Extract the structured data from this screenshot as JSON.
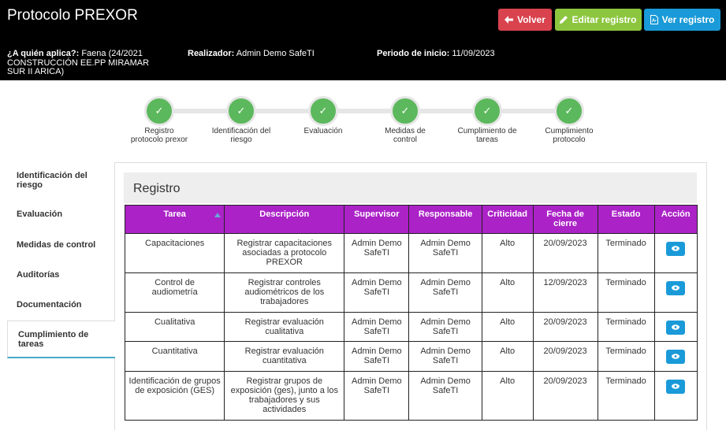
{
  "header": {
    "title": "Protocolo PREXOR",
    "buttons": {
      "back": "Volver",
      "edit": "Editar registro",
      "view": "Ver registro"
    },
    "meta": {
      "apply_label": "¿A quién aplica?:",
      "apply_value": "Faena (24/2021 CONSTRUCCIÓN EE.PP MIRAMAR SUR II ARICA)",
      "realizer_label": "Realizador:",
      "realizer_value": "Admin Demo SafeTI",
      "period_label": "Periodo de inicio:",
      "period_value": "11/09/2023"
    }
  },
  "steps": [
    {
      "label": "Registro protocolo prexor"
    },
    {
      "label": "Identificación del riesgo"
    },
    {
      "label": "Evaluación"
    },
    {
      "label": "Medidas de control"
    },
    {
      "label": "Cumplimiento de tareas"
    },
    {
      "label": "Cumplimiento protocolo"
    }
  ],
  "sidebar": {
    "items": [
      {
        "label": "Identificación del riesgo"
      },
      {
        "label": "Evaluación"
      },
      {
        "label": "Medidas de control"
      },
      {
        "label": "Auditorías"
      },
      {
        "label": "Documentación"
      },
      {
        "label": "Cumplimiento de tareas"
      }
    ]
  },
  "section": {
    "title": "Registro"
  },
  "table": {
    "columns": [
      "Tarea",
      "Descripción",
      "Supervisor",
      "Responsable",
      "Criticidad",
      "Fecha de cierre",
      "Estado",
      "Acción"
    ],
    "rows": [
      {
        "tarea": "Capacitaciones",
        "descripcion": "Registrar capacitaciones asociadas a protocolo PREXOR",
        "supervisor": "Admin Demo SafeTI",
        "responsable": "Admin Demo SafeTI",
        "criticidad": "Alto",
        "fecha": "20/09/2023",
        "estado": "Terminado"
      },
      {
        "tarea": "Control de audiometría",
        "descripcion": "Registrar controles audiométricos de los trabajadores",
        "supervisor": "Admin Demo SafeTI",
        "responsable": "Admin Demo SafeTI",
        "criticidad": "Alto",
        "fecha": "12/09/2023",
        "estado": "Terminado"
      },
      {
        "tarea": "Cualitativa",
        "descripcion": "Registrar evaluación cualitativa",
        "supervisor": "Admin Demo SafeTI",
        "responsable": "Admin Demo SafeTI",
        "criticidad": "Alto",
        "fecha": "20/09/2023",
        "estado": "Terminado"
      },
      {
        "tarea": "Cuantitativa",
        "descripcion": "Registrar evaluación cuantitativa",
        "supervisor": "Admin Demo SafeTI",
        "responsable": "Admin Demo SafeTI",
        "criticidad": "Alto",
        "fecha": "20/09/2023",
        "estado": "Terminado"
      },
      {
        "tarea": "Identificación de grupos de exposición (GES)",
        "descripcion": "Registrar grupos de exposición (ges), junto a los trabajadores y sus actividades",
        "supervisor": "Admin Demo SafeTI",
        "responsable": "Admin Demo SafeTI",
        "criticidad": "Alto",
        "fecha": "20/09/2023",
        "estado": "Terminado"
      }
    ]
  },
  "colors": {
    "header_bg": "#000000",
    "back": "#d9434e",
    "edit": "#8cc63f",
    "view": "#1a9ad8",
    "table_header": "#ab22c7",
    "step_done": "#5cb85c",
    "active_tab_border": "#4aa9c9"
  }
}
